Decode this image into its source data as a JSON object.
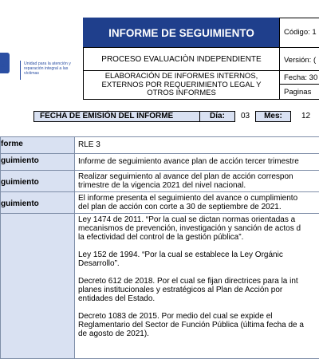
{
  "logo": {
    "brand_line1": "ro",
    "brand_line2": "dos",
    "tagline": "Unidad para la atención y reparación integral a las víctimas"
  },
  "header": {
    "title": "INFORME DE SEGUIMIENTO",
    "process": "PROCESO EVALUACIÒN INDEPENDIENTE",
    "subprocess_line1": "ELABORACIÓN DE INFORMES INTERNOS,",
    "subprocess_line2": "EXTERNOS POR REQUERIMIENTO LEGAL Y",
    "subprocess_line3": "OTROS INFORMES",
    "code": "Código: 1",
    "version": "Versión: (",
    "date": "Fecha: 30",
    "pages": "Paginas"
  },
  "emission": {
    "label": "FECHA DE EMISIÓN DEL INFORME",
    "day_label": "Día:",
    "day_value": "03",
    "month_label": "Mes:",
    "month_value": "12"
  },
  "rows": [
    {
      "label": "forme",
      "lines": [
        "RLE 3"
      ]
    },
    {
      "label": "guimiento",
      "lines": [
        "Informe de seguimiento avance plan de acción tercer trimestre"
      ]
    },
    {
      "label": "guimiento",
      "lines": [
        "Realizar seguimiento al avance del plan de acción correspon",
        "trimestre de la vigencia 2021 del nivel nacional."
      ]
    },
    {
      "label": "guimiento",
      "lines": [
        "El informe presenta el seguimiento del avance o cumplimiento",
        "del plan de acción con corte a 30 de septiembre de 2021."
      ]
    }
  ],
  "legal": {
    "p1": [
      "Ley 1474 de 2011. “Por la cual se dictan normas orientadas a",
      "mecanismos de prevención, investigación y sanción de actos d",
      "la efectividad del control de la gestión pública”."
    ],
    "p2": [
      "Ley 152 de 1994. “Por la cual se establece la Ley Orgánic",
      "Desarrollo”."
    ],
    "p3": [
      "Decreto 612 de 2018. Por el cual se fijan directrices para la int",
      "planes institucionales y estratégicos al Plan de Acción por",
      "entidades del Estado."
    ],
    "p4": [
      "Decreto 1083 de 2015. Por medio del cual se expide el",
      "Reglamentario del Sector de Función Pública (última fecha de a",
      "de agosto de 2021)."
    ]
  }
}
